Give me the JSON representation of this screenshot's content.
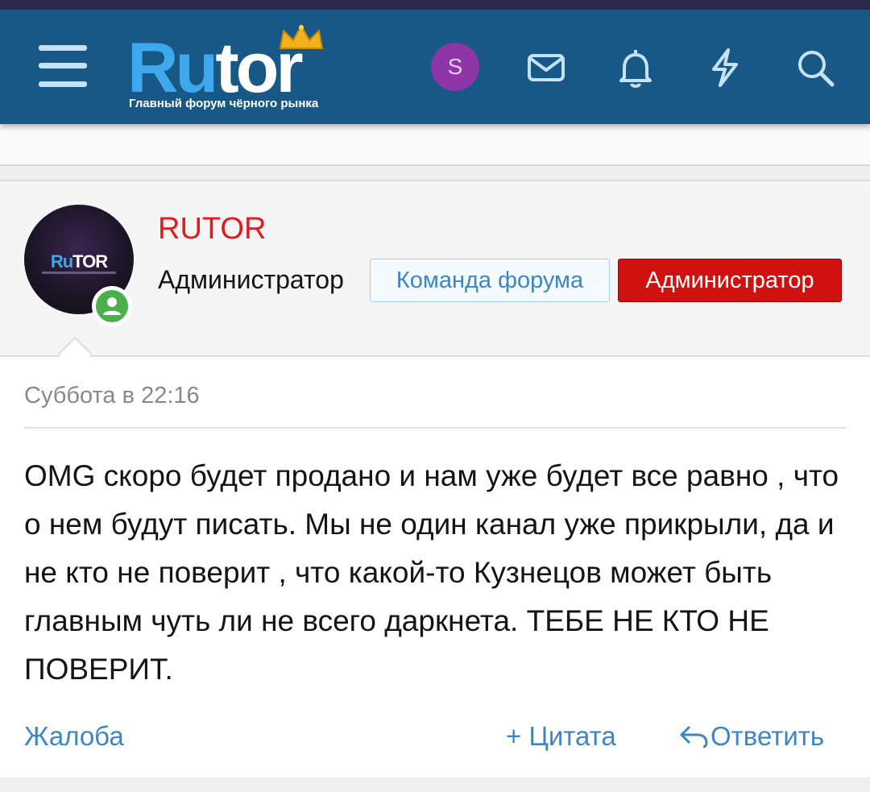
{
  "header": {
    "logo_text": "Rutor",
    "logo_tagline": "Главный форум чёрного рынка",
    "user_initial": "S",
    "icons": [
      "menu-icon",
      "mail-icon",
      "bell-icon",
      "lightning-icon",
      "search-icon"
    ],
    "colors": {
      "bar": "#185886",
      "accent": "#3ea8ee",
      "avatar": "#8e36a8"
    }
  },
  "post": {
    "avatar_text": "RuTOR",
    "username": "RUTOR",
    "user_title": "Администратор",
    "badges": [
      "Команда форума",
      "Администратор"
    ],
    "date": "Суббота в 22:16",
    "message": "OMG скоро будет продано и нам уже будет все равно , что о нем будут писать. Мы не один канал уже прикрыли, да и не кто не поверит , что какой-то Кузнецов может быть главным чуть ли не всего даркнета. ТЕБЕ НЕ КТО НЕ ПОВЕРИТ.",
    "actions": {
      "report": "Жалоба",
      "quote": "+ Цитата",
      "reply": "Ответить"
    },
    "colors": {
      "username": "#e01b1b",
      "admin_badge": "#d11010",
      "link": "#3e86c2",
      "online": "#4ab04a"
    }
  }
}
